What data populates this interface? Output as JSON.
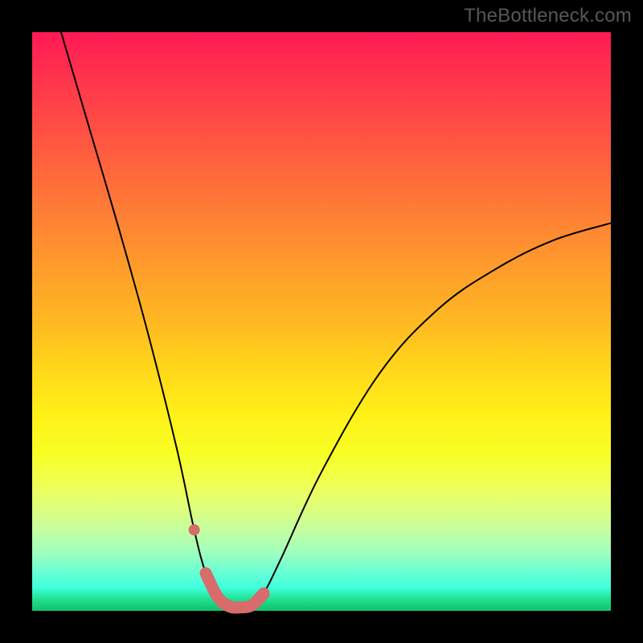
{
  "watermark": "TheBottleneck.com",
  "chart_data": {
    "type": "line",
    "title": "",
    "xlabel": "",
    "ylabel": "",
    "xlim": [
      0,
      100
    ],
    "ylim": [
      0,
      100
    ],
    "grid": false,
    "series": [
      {
        "name": "bottleneck-curve",
        "x": [
          5,
          10,
          15,
          20,
          25,
          28,
          30,
          32,
          34,
          36,
          38,
          40,
          43,
          50,
          60,
          70,
          80,
          90,
          100
        ],
        "values": [
          100,
          83,
          66,
          48,
          28,
          14,
          6.5,
          2.5,
          0.8,
          0.6,
          1.0,
          3.0,
          9.0,
          24,
          41,
          52,
          59,
          64,
          67
        ]
      }
    ],
    "highlight_segment": {
      "name": "minimum-band",
      "x": [
        30,
        32,
        34,
        36,
        38,
        40
      ],
      "values": [
        6.5,
        2.5,
        0.8,
        0.6,
        1.0,
        3.0
      ]
    },
    "highlight_dot": {
      "x": 28,
      "value": 14
    },
    "background_gradient": {
      "top": "#ff1a55",
      "mid": "#fff018",
      "bottom": "#10c06a"
    }
  }
}
